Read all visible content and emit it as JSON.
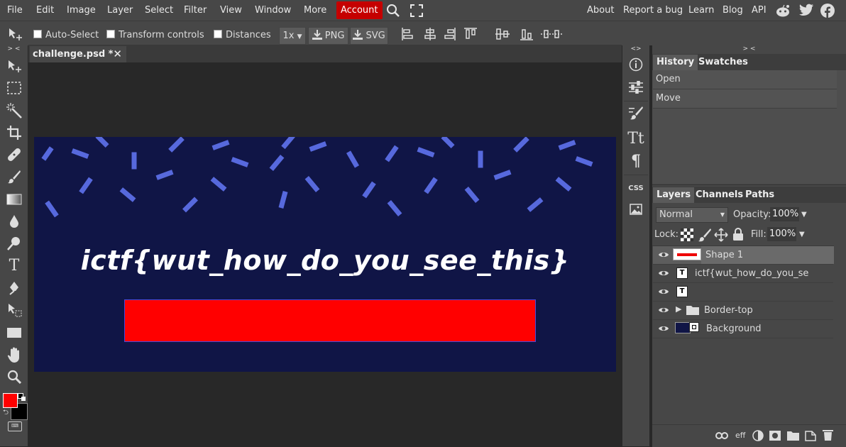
{
  "menu": {
    "items": [
      "File",
      "Edit",
      "Image",
      "Layer",
      "Select",
      "Filter",
      "View",
      "Window",
      "More"
    ],
    "account": "Account",
    "right_links": [
      "About",
      "Report a bug",
      "Learn",
      "Blog",
      "API"
    ],
    "accent_color": "#c50000"
  },
  "options": {
    "auto_select": "Auto-Select",
    "transform_controls": "Transform controls",
    "distances": "Distances",
    "zoom": "1x",
    "png": "PNG",
    "svg": "SVG"
  },
  "document": {
    "tab_title": "challenge.psd *",
    "flag_text": "ictf{wut_how_do_you_see_this}",
    "background_color": "#101546",
    "confetti_color": "#5769dd",
    "box_color": "#ff0000"
  },
  "colors": {
    "foreground": "#ff0000",
    "background": "#000000"
  },
  "history_panel": {
    "tabs": [
      "History",
      "Swatches"
    ],
    "entries": [
      "Open",
      "Move"
    ]
  },
  "layers_panel": {
    "tabs": [
      "Layers",
      "Channels",
      "Paths"
    ],
    "blend_mode": "Normal",
    "opacity_label": "Opacity:",
    "opacity": "100%",
    "lock_label": "Lock:",
    "fill_label": "Fill:",
    "fill": "100%",
    "layers": [
      {
        "name": "Shape 1",
        "type": "shape"
      },
      {
        "name": "ictf{wut_how_do_you_se",
        "type": "text"
      },
      {
        "name": "",
        "type": "text"
      },
      {
        "name": "Border-top",
        "type": "folder"
      },
      {
        "name": "Background",
        "type": "image"
      }
    ],
    "footer_eff": "eff"
  },
  "icons": {
    "social": [
      "reddit-icon",
      "twitter-icon",
      "facebook-icon"
    ],
    "mini_tools": [
      "info-icon",
      "adjustments-icon",
      "brush-settings-icon",
      "character-icon",
      "paragraph-icon",
      "css-icon",
      "image-icon"
    ],
    "css_label": "CSS"
  }
}
